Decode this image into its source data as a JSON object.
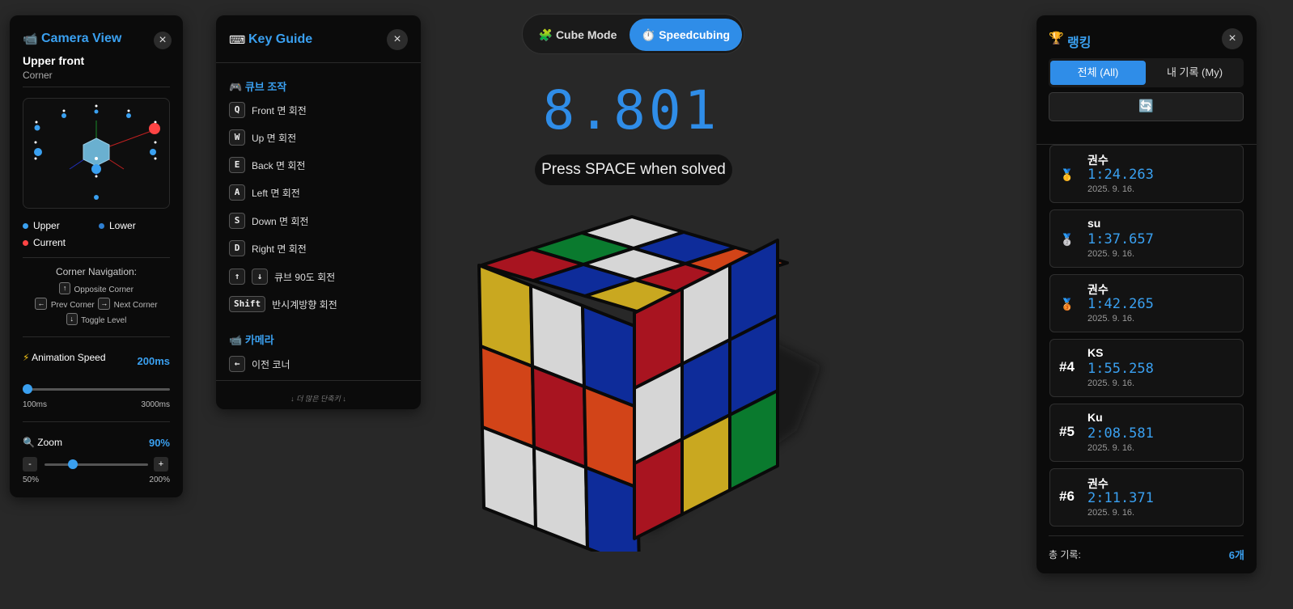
{
  "camera": {
    "title": "Camera View",
    "title_icon": "camera-icon",
    "view_name": "Upper front",
    "view_sub": "Corner",
    "legend": {
      "upper": "Upper",
      "lower": "Lower",
      "current": "Current"
    },
    "nav_title": "Corner Navigation:",
    "nav_items": {
      "opposite_key": "↑",
      "opposite": "Opposite Corner",
      "prev_key": "←",
      "prev": "Prev Corner",
      "next_key": "→",
      "next": "Next Corner",
      "toggle_key": "↓",
      "toggle": "Toggle Level"
    },
    "anim": {
      "icon": "⚡",
      "label": "Animation Speed",
      "value": "200ms",
      "min": "100ms",
      "max": "3000ms",
      "level": 0.035
    },
    "zoom": {
      "icon": "🔍",
      "label": "Zoom",
      "value": "90%",
      "min": "50%",
      "max": "200%",
      "minus": "-",
      "plus": "+",
      "level": 0.27
    },
    "colors": {
      "accent": "#3aa0f0",
      "current": "#ff4444"
    }
  },
  "keyguide": {
    "title": "Key Guide",
    "title_icon": "keyboard-icon",
    "section1": "큐브 조작",
    "section1_icon": "🎮",
    "rows": [
      {
        "key": "Q",
        "label": "Front 면 회전"
      },
      {
        "key": "W",
        "label": "Up 면 회전"
      },
      {
        "key": "E",
        "label": "Back 면 회전"
      },
      {
        "key": "A",
        "label": "Left 면 회전"
      },
      {
        "key": "S",
        "label": "Down 면 회전"
      },
      {
        "key": "D",
        "label": "Right 면 회전"
      }
    ],
    "rotate_keys": [
      "↑",
      "↓"
    ],
    "rotate_label": "큐브 90도 회전",
    "shift_key": "Shift",
    "shift_label": "반시계방향 회전",
    "section2": "카메라",
    "section2_icon": "📹",
    "camera_row": {
      "key": "←",
      "label": "이전 코너"
    },
    "footer": "↓ 더 많은 단축키 ↓"
  },
  "mode": {
    "cube_label": "Cube Mode",
    "cube_icon": "🧩",
    "speed_label": "Speedcubing",
    "speed_icon": "⏱️",
    "active": "speedcubing"
  },
  "timer": {
    "value": "8.801",
    "hint": "Press SPACE when solved"
  },
  "ranking": {
    "title": "랭킹",
    "title_icon": "🏆",
    "tabs": [
      "전체 (All)",
      "내 기록 (My)"
    ],
    "refresh_icon": "🔄",
    "entries": [
      {
        "rank": "1",
        "badge": "🥇",
        "name": "권수",
        "time": "1:24.263",
        "date": "2025. 9. 16."
      },
      {
        "rank": "2",
        "badge": "🥈",
        "name": "su",
        "time": "1:37.657",
        "date": "2025. 9. 16."
      },
      {
        "rank": "3",
        "badge": "🥉",
        "name": "권수",
        "time": "1:42.265",
        "date": "2025. 9. 16."
      },
      {
        "rank": "#4",
        "badge": "",
        "name": "KS",
        "time": "1:55.258",
        "date": "2025. 9. 16."
      },
      {
        "rank": "#5",
        "badge": "",
        "name": "Ku",
        "time": "2:08.581",
        "date": "2025. 9. 16."
      },
      {
        "rank": "#6",
        "badge": "",
        "name": "권수",
        "time": "2:11.371",
        "date": "2025. 9. 16."
      }
    ],
    "total_label": "총 기록:",
    "total_value": "6개"
  },
  "cube_colors": {
    "white": "#d6d6d6",
    "yellow": "#c9a820",
    "red": "#a81420",
    "orange": "#d24418",
    "blue": "#0e2c9a",
    "green": "#0a7a2e"
  }
}
